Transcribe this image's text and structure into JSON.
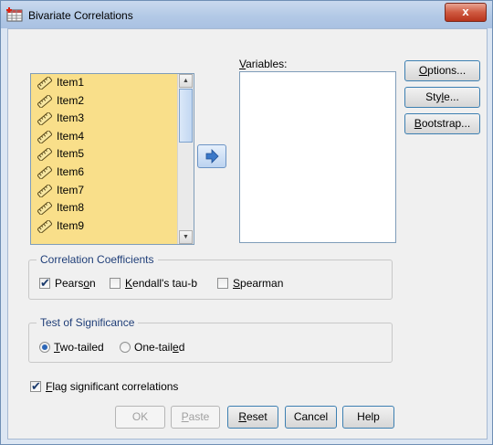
{
  "window": {
    "title": "Bivariate Correlations",
    "close_glyph": "x"
  },
  "source_list": {
    "items": [
      "Item1",
      "Item2",
      "Item3",
      "Item4",
      "Item5",
      "Item6",
      "Item7",
      "Item8",
      "Item9"
    ],
    "icon": "ruler-icon"
  },
  "move_button": {
    "icon": "arrow-right-icon"
  },
  "variables": {
    "label": "Variables:"
  },
  "side_buttons": {
    "options": "Options...",
    "style": "Style...",
    "bootstrap": "Bootstrap..."
  },
  "correlation_coefficients": {
    "label": "Correlation Coefficients",
    "pearson": {
      "label": "Pearson",
      "checked": true
    },
    "kendall": {
      "label": "Kendall's tau-b",
      "checked": false
    },
    "spearman": {
      "label": "Spearman",
      "checked": false
    }
  },
  "test_of_significance": {
    "label": "Test of Significance",
    "two_tailed": {
      "label": "Two-tailed",
      "selected": true
    },
    "one_tailed": {
      "label": "One-tailed",
      "selected": false
    }
  },
  "flag_significant": {
    "label": "Flag significant correlations",
    "checked": true
  },
  "buttons": {
    "ok": "OK",
    "paste": "Paste",
    "reset": "Reset",
    "cancel": "Cancel",
    "help": "Help"
  },
  "colors": {
    "list_background": "#f9df8a",
    "group_label": "#1f3e78",
    "title_bar": "#b3c9e6",
    "close_button": "#cf5a41"
  }
}
